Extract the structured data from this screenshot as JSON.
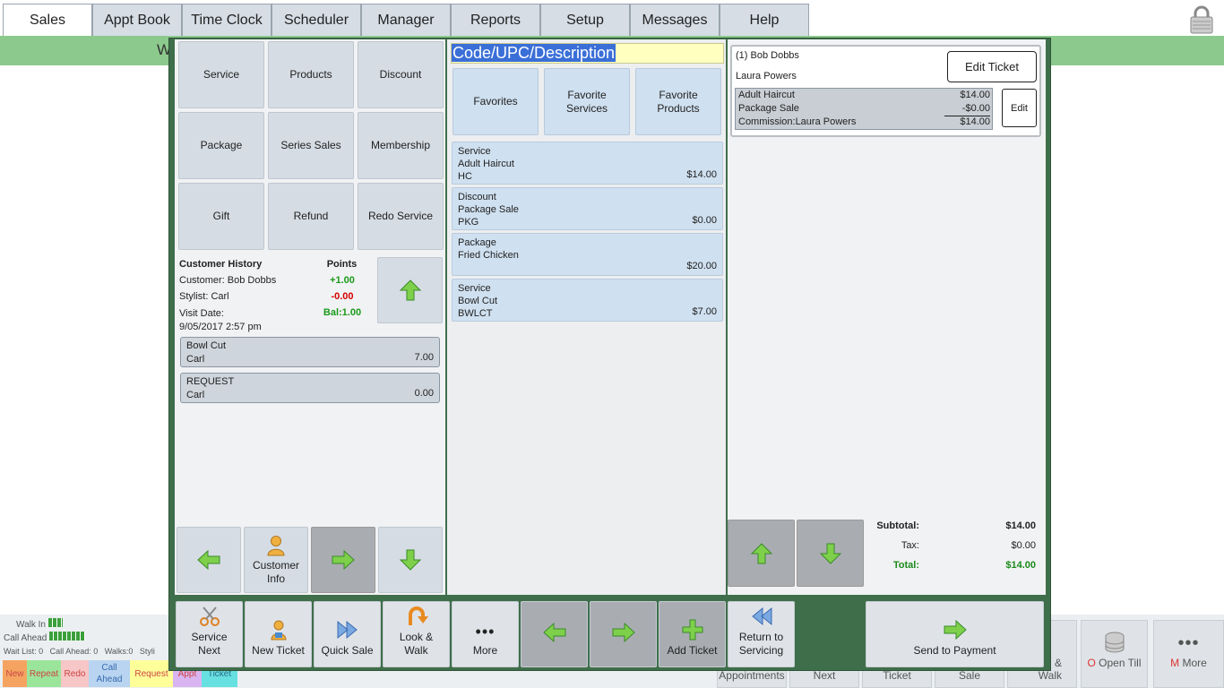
{
  "tabs": [
    "Sales",
    "Appt Book",
    "Time Clock",
    "Scheduler",
    "Manager",
    "Reports",
    "Setup",
    "Messages",
    "Help"
  ],
  "greenbar_text": "W",
  "categories": [
    "Service",
    "Products",
    "Discount",
    "Package",
    "Series Sales",
    "Membership",
    "Gift",
    "Refund",
    "Redo Service"
  ],
  "search": {
    "value": "Code/UPC/Description"
  },
  "favorites": [
    "Favorites",
    "Favorite Services",
    "Favorite Products"
  ],
  "items": [
    {
      "type": "Service",
      "name": "Adult Haircut",
      "code": "HC",
      "price": "$14.00"
    },
    {
      "type": "Discount",
      "name": "Package Sale",
      "code": "PKG",
      "price": "$0.00"
    },
    {
      "type": "Package",
      "name": "Fried Chicken",
      "code": "",
      "price": "$20.00"
    },
    {
      "type": "Service",
      "name": "Bowl Cut",
      "code": "BWLCT",
      "price": "$7.00"
    }
  ],
  "history": {
    "title": "Customer History",
    "points_label": "Points",
    "customer": "Customer: Bob Dobbs",
    "stylist": "Stylist: Carl",
    "visit_label": "Visit Date:",
    "visit_date": "9/05/2017 2:57 pm",
    "plus": "+1.00",
    "minus": "-0.00",
    "balance": "Bal:1.00",
    "entries": [
      {
        "name": "Bowl Cut",
        "stylist": "Carl",
        "amount": "7.00"
      },
      {
        "name": "REQUEST",
        "stylist": "Carl",
        "amount": "0.00"
      }
    ]
  },
  "nav": {
    "customer_info": "Customer Info"
  },
  "ticket": {
    "customer": "(1) Bob Dobbs",
    "stylist": "Laura Powers",
    "edit_ticket": "Edit Ticket",
    "edit": "Edit",
    "lines": [
      {
        "label": "Adult Haircut",
        "amount": "$14.00"
      },
      {
        "label": "Package Sale",
        "amount": "-$0.00"
      },
      {
        "label": "Commission:Laura Powers",
        "amount": "$14.00"
      }
    ]
  },
  "totals": {
    "subtotal_label": "Subtotal:",
    "subtotal": "$14.00",
    "tax_label": "Tax:",
    "tax": "$0.00",
    "total_label": "Total:",
    "total": "$14.00"
  },
  "toolbar": {
    "service_next": "Service Next",
    "new_ticket": "New Ticket",
    "quick_sale": "Quick Sale",
    "look_walk": "Look & Walk",
    "more": "More",
    "add_ticket": "Add Ticket",
    "return": "Return to Servicing",
    "send_payment": "Send to Payment"
  },
  "status": {
    "walk_in": "Walk In",
    "call_ahead": "Call Ahead",
    "counts": "Wait List: 0   Call Ahead: 0   Walks:0   Styli"
  },
  "legend": [
    "New",
    "Repeat",
    "Redo",
    "Call Ahead",
    "Request",
    "Appt",
    "Ticket"
  ],
  "legend_colors": [
    "#f4a460",
    "#9be59b",
    "#f7c6c6",
    "#b8d4f0",
    "#ffff99",
    "#d8b4f0",
    "#66e0e0"
  ],
  "background_buttons": {
    "open_till": "Open Till",
    "more": "More",
    "open_till_prefix": "O",
    "more_prefix": "M",
    "appointments": "Appointments",
    "next": "Next",
    "ticket": "Ticket",
    "sale": "Sale",
    "walk": "Walk",
    "amp": "&"
  },
  "colors": {
    "accent_green": "#3f6e4a",
    "plus": "#1a9a1a",
    "minus": "#d40000"
  }
}
